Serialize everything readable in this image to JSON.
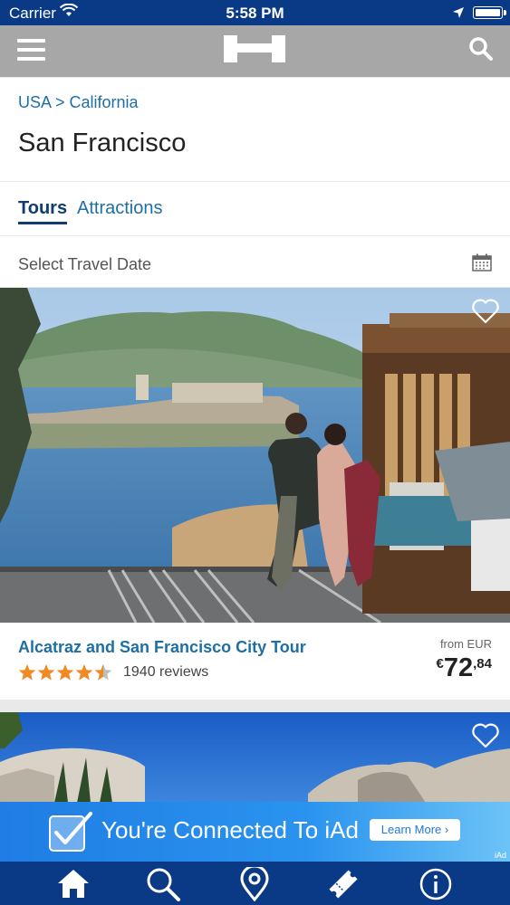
{
  "status_bar": {
    "carrier": "Carrier",
    "time": "5:58 PM"
  },
  "nav": {
    "menu_icon": "hamburger-icon",
    "logo_icon": "hotels-h-logo",
    "search_icon": "search-icon"
  },
  "location": {
    "breadcrumb": "USA > California",
    "city": "San Francisco"
  },
  "tabs": [
    {
      "label": "Tours",
      "active": true
    },
    {
      "label": "Attractions",
      "active": false
    }
  ],
  "date_filter": {
    "label": "Select Travel Date",
    "icon": "calendar-icon"
  },
  "tour": {
    "title": "Alcatraz and San Francisco City Tour",
    "rating": 4.5,
    "reviews": "1940 reviews",
    "price_from": "from EUR",
    "price_currency": "€",
    "price_int": "72",
    "price_dec": ",84"
  },
  "ad": {
    "text": "You're Connected To iAd",
    "cta": "Learn More ›",
    "tag": "iAd"
  },
  "bottom_tabs": [
    "home-icon",
    "search-icon",
    "map-pin-icon",
    "ticket-icon",
    "info-icon"
  ],
  "colors": {
    "status_bar": "#0a3a86",
    "nav_bar": "#a7a7a7",
    "link": "#1d6fa5",
    "tab_active": "#0f3d6e",
    "star": "#f08a24"
  }
}
